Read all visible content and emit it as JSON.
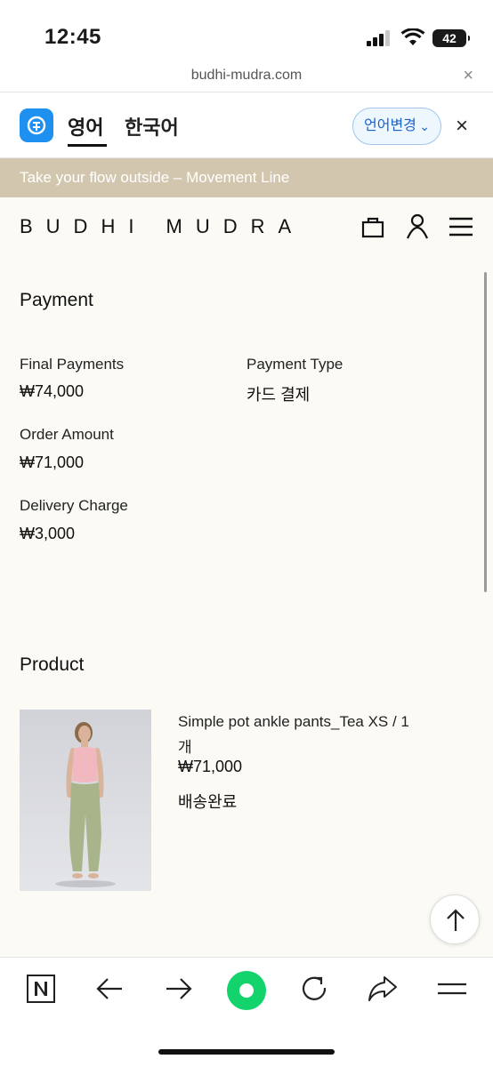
{
  "status": {
    "time": "12:45",
    "battery": "42"
  },
  "browser": {
    "url": "budhi-mudra.com",
    "close": "×"
  },
  "translate_bar": {
    "lang_en": "영어",
    "lang_ko": "한국어",
    "change_button": "언어변경",
    "chevron": "⌄",
    "close": "×"
  },
  "promo": "Take your flow outside – Movement Line",
  "brand": "BUDHI MUDRA",
  "payment": {
    "heading": "Payment",
    "final_label": "Final Payments",
    "final_value": "₩74,000",
    "type_label": "Payment Type",
    "type_value": "카드 결제",
    "order_label": "Order Amount",
    "order_value": "₩71,000",
    "delivery_label": "Delivery Charge",
    "delivery_value": "₩3,000"
  },
  "product": {
    "heading": "Product",
    "name": "Simple pot ankle pants_Tea XS / 1",
    "name_cont": "개",
    "price": "₩71,000",
    "status": "배송완료"
  },
  "colors": {
    "promo_bg": "#d2c7ae",
    "accent_blue": "#1e90f0",
    "toolbar_green": "#12d36c"
  },
  "icons": [
    "signal-icon",
    "wifi-icon",
    "battery-icon",
    "translate-app-icon",
    "bag-icon",
    "user-icon",
    "menu-icon",
    "arrow-up-icon",
    "naver-n-icon",
    "back-arrow-icon",
    "forward-arrow-icon",
    "green-dot-icon",
    "refresh-icon",
    "share-icon",
    "browser-menu-icon"
  ]
}
